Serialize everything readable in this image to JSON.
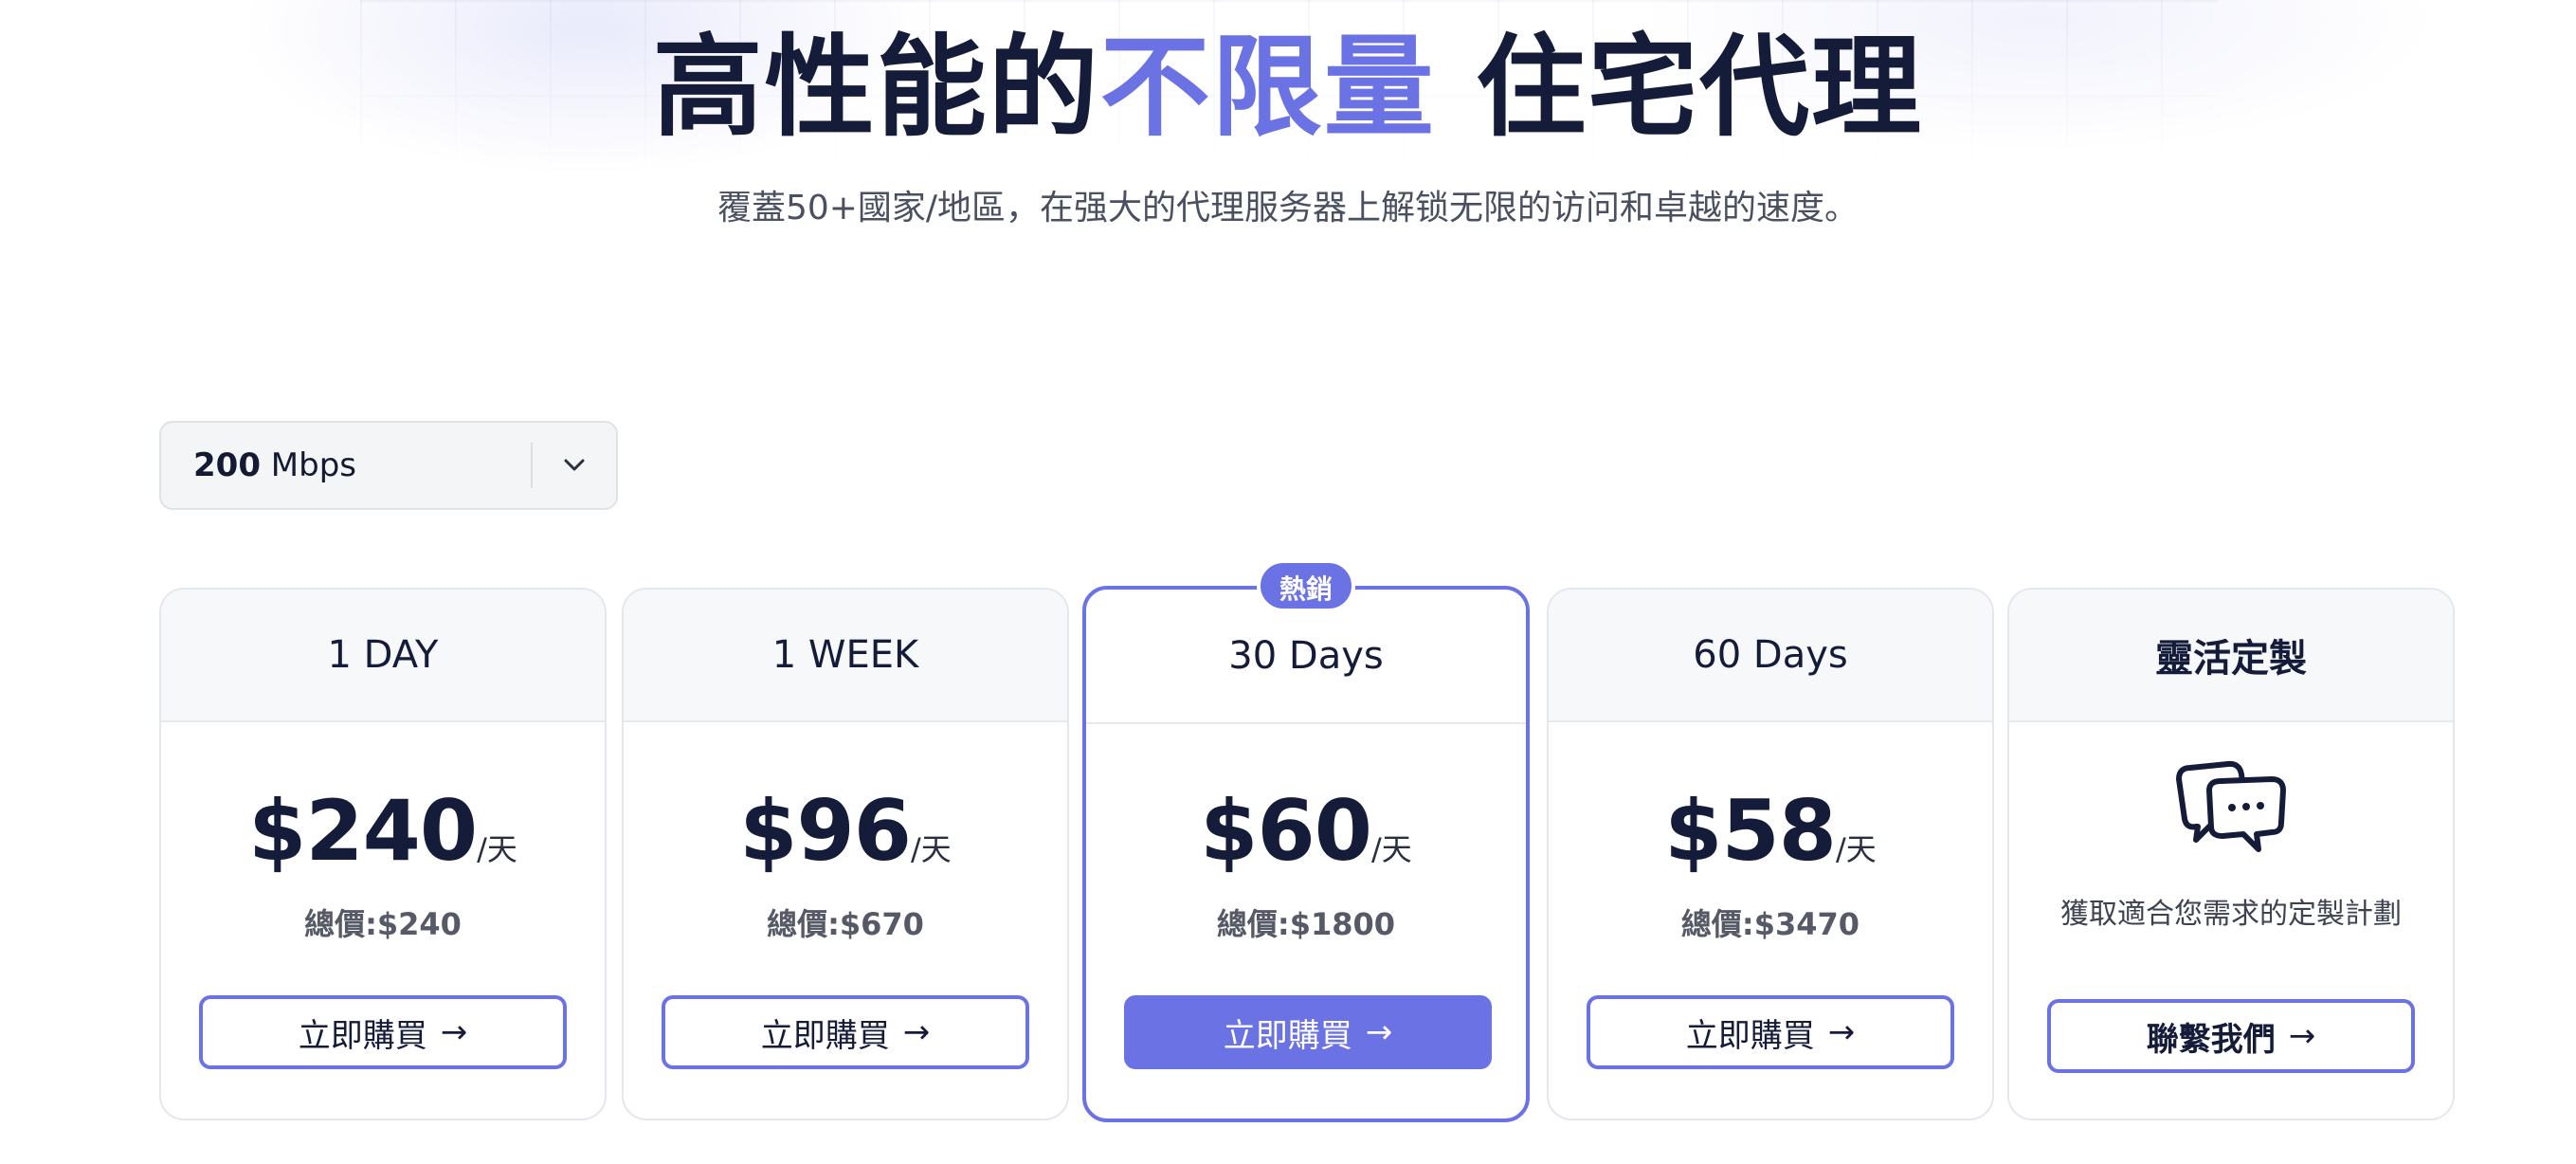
{
  "hero": {
    "title_before": "高性能的",
    "title_accent": "不限量",
    "title_after": "住宅代理",
    "subtitle": "覆蓋50+國家/地區，在强大的代理服务器上解锁无限的访问和卓越的速度。"
  },
  "selector": {
    "value_number": "200",
    "value_unit": "Mbps",
    "icon": "chevron-down-icon"
  },
  "colors": {
    "accent": "#6b72e4",
    "heading": "#141c3a"
  },
  "plans": [
    {
      "name": "1 DAY",
      "price": "$240",
      "unit": "/天",
      "total": "總價:$240",
      "button": "立即購買",
      "popular": false
    },
    {
      "name": "1 WEEK",
      "price": "$96",
      "unit": "/天",
      "total": "總價:$670",
      "button": "立即購買",
      "popular": false
    },
    {
      "name": "30 Days",
      "price": "$60",
      "unit": "/天",
      "total": "總價:$1800",
      "button": "立即購買",
      "popular": true,
      "badge": "熱銷"
    },
    {
      "name": "60 Days",
      "price": "$58",
      "unit": "/天",
      "total": "總價:$3470",
      "button": "立即購買",
      "popular": false
    }
  ],
  "custom_plan": {
    "name": "靈活定製",
    "icon": "chat-bubbles-icon",
    "description": "獲取適合您需求的定製計劃",
    "button": "聯繫我們"
  },
  "arrow_glyph": "→"
}
